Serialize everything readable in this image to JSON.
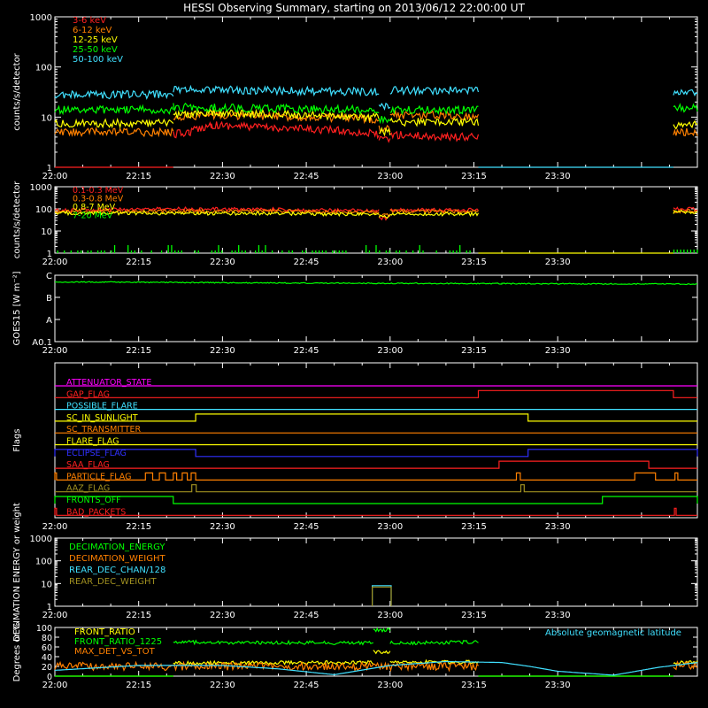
{
  "title": "HESSI Observing Summary, starting on 2013/06/12 22:00:00 UT",
  "time_ticks": [
    "22:00",
    "22:15",
    "22:30",
    "22:45",
    "23:00",
    "23:15",
    "23:30"
  ],
  "colors": {
    "red": "#ff2020",
    "orange": "#ff8000",
    "yellow": "#ffff00",
    "green": "#00ff00",
    "cyan": "#40e0ff",
    "magenta": "#ff00ff",
    "blue": "#3030ff",
    "olive": "#a09020",
    "white": "#ffffff",
    "frame": "#ffffff"
  },
  "chart_data": [
    {
      "type": "line",
      "ylabel": "counts/s/detector",
      "yscale": "log",
      "ylim": [
        1,
        1000
      ],
      "ytick_labels": [
        "1",
        "10",
        "100",
        "1000"
      ],
      "x_unit": "minutes since 22:00",
      "series": [
        {
          "name": "3-6 keV",
          "color": "#ff2020",
          "segments": [
            {
              "x": [
                0,
                21.2
              ],
              "y": [
                1,
                1
              ]
            },
            {
              "x": [
                21.2,
                24,
                28,
                40,
                50,
                58
              ],
              "y": [
                4.5,
                5,
                7,
                6,
                5.5,
                4.5
              ]
            },
            {
              "x": [
                58,
                60
              ],
              "y": [
                3.5,
                3.5
              ]
            },
            {
              "x": [
                60,
                70,
                75.8
              ],
              "y": [
                4.5,
                4,
                4
              ]
            }
          ]
        },
        {
          "name": "6-12 keV",
          "color": "#ff8000",
          "segments": [
            {
              "x": [
                0,
                21.2
              ],
              "y": [
                5,
                5
              ]
            },
            {
              "x": [
                21.2,
                28,
                45,
                58
              ],
              "y": [
                10,
                11,
                10,
                9
              ]
            },
            {
              "x": [
                58,
                60
              ],
              "y": [
                6,
                6
              ]
            },
            {
              "x": [
                60,
                70,
                75.8
              ],
              "y": [
                11,
                11,
                10
              ]
            },
            {
              "x": [
                110.7,
                115
              ],
              "y": [
                5,
                5
              ]
            }
          ]
        },
        {
          "name": "12-25 keV",
          "color": "#ffff00",
          "segments": [
            {
              "x": [
                0,
                21.2
              ],
              "y": [
                7.5,
                7.5
              ]
            },
            {
              "x": [
                21.2,
                28,
                45,
                58
              ],
              "y": [
                11,
                12,
                11,
                10
              ]
            },
            {
              "x": [
                58,
                60
              ],
              "y": [
                5,
                5
              ]
            },
            {
              "x": [
                60,
                75.8
              ],
              "y": [
                8,
                8
              ]
            },
            {
              "x": [
                110.7,
                115
              ],
              "y": [
                7,
                7
              ]
            }
          ]
        },
        {
          "name": "25-50 keV",
          "color": "#00ff00",
          "segments": [
            {
              "x": [
                0,
                21.2
              ],
              "y": [
                14,
                14
              ]
            },
            {
              "x": [
                21.2,
                35,
                58
              ],
              "y": [
                16,
                15,
                14
              ]
            },
            {
              "x": [
                58,
                60
              ],
              "y": [
                9,
                9
              ]
            },
            {
              "x": [
                60,
                75.8
              ],
              "y": [
                14,
                14
              ]
            },
            {
              "x": [
                110.7,
                115
              ],
              "y": [
                15,
                15
              ]
            }
          ]
        },
        {
          "name": "50-100 keV",
          "color": "#40e0ff",
          "segments": [
            {
              "x": [
                0,
                21.2
              ],
              "y": [
                28,
                28
              ]
            },
            {
              "x": [
                21.2,
                35,
                58
              ],
              "y": [
                36,
                34,
                32
              ]
            },
            {
              "x": [
                58,
                60
              ],
              "y": [
                17,
                17
              ]
            },
            {
              "x": [
                60,
                75.8
              ],
              "y": [
                34,
                34
              ]
            },
            {
              "x": [
                75.8,
                110.7
              ],
              "y": [
                1,
                1
              ]
            },
            {
              "x": [
                110.7,
                115
              ],
              "y": [
                32,
                32
              ]
            }
          ]
        }
      ]
    },
    {
      "type": "line",
      "ylabel": "counts/s/detector",
      "yscale": "log",
      "ylim": [
        1,
        1000
      ],
      "ytick_labels": [
        "1",
        "10",
        "100",
        "1000"
      ],
      "x_unit": "minutes since 22:00",
      "series": [
        {
          "name": "0.1-0.3 MeV",
          "color": "#ff2020",
          "segments": [
            {
              "x": [
                0,
                21.2,
                40,
                58
              ],
              "y": [
                85,
                100,
                95,
                80
              ]
            },
            {
              "x": [
                58,
                60
              ],
              "y": [
                38,
                38
              ]
            },
            {
              "x": [
                60,
                75.8
              ],
              "y": [
                90,
                88
              ]
            },
            {
              "x": [
                110.7,
                115
              ],
              "y": [
                100,
                100
              ]
            }
          ]
        },
        {
          "name": "0.3-0.8 MeV",
          "color": "#ff8000",
          "segments": [
            {
              "x": [
                0,
                40,
                58
              ],
              "y": [
                75,
                80,
                70
              ]
            },
            {
              "x": [
                58,
                60
              ],
              "y": [
                55,
                55
              ]
            },
            {
              "x": [
                60,
                75.8
              ],
              "y": [
                78,
                75
              ]
            },
            {
              "x": [
                110.7,
                115
              ],
              "y": [
                80,
                80
              ]
            }
          ]
        },
        {
          "name": "0.8-7 MeV",
          "color": "#ffff00",
          "segments": [
            {
              "x": [
                0,
                40,
                58
              ],
              "y": [
                65,
                62,
                55
              ]
            },
            {
              "x": [
                58,
                60
              ],
              "y": [
                45,
                45
              ]
            },
            {
              "x": [
                60,
                75.8
              ],
              "y": [
                60,
                58
              ]
            },
            {
              "x": [
                75.8,
                110.7
              ],
              "y": [
                1,
                1
              ]
            },
            {
              "x": [
                110.7,
                115
              ],
              "y": [
                70,
                70
              ]
            }
          ]
        },
        {
          "name": "7-20 MeV",
          "color": "#00ff00",
          "noise": true,
          "segments": [
            {
              "x": [
                0,
                75.8
              ],
              "y": [
                1,
                1
              ]
            },
            {
              "x": [
                110.7,
                115
              ],
              "y": [
                1,
                1
              ]
            }
          ]
        }
      ]
    },
    {
      "type": "line",
      "ylabel": "GOES15 [W m⁻²]",
      "ytick_labels": [
        "A0.1",
        "A",
        "B",
        "C"
      ],
      "series": [
        {
          "name": "GOES15",
          "color": "#00ff00",
          "segments": [
            {
              "x": [
                0,
                40,
                80,
                115
              ],
              "y": [
                2.7,
                2.65,
                2.62,
                2.6
              ]
            }
          ]
        }
      ]
    },
    {
      "type": "table",
      "ylabel": "Flags",
      "flags": [
        {
          "name": "ATTENUATOR_STATE",
          "color": "#ff00ff",
          "high": []
        },
        {
          "name": "GAP_FLAG",
          "color": "#ff2020",
          "high": [
            [
              75.8,
              110.7
            ]
          ]
        },
        {
          "name": "POSSIBLE_FLARE",
          "color": "#40e0ff",
          "high": []
        },
        {
          "name": "SC_IN_SUNLIGHT",
          "color": "#ffff00",
          "high": [
            [
              25.2,
              84.7
            ]
          ]
        },
        {
          "name": "SC_TRANSMITTER",
          "color": "#ff8000",
          "high": []
        },
        {
          "name": "FLARE_FLAG",
          "color": "#ffff00",
          "high": []
        },
        {
          "name": "ECLIPSE_FLAG",
          "color": "#3030ff",
          "high": [
            [
              0,
              25.2
            ],
            [
              84.7,
              115
            ]
          ]
        },
        {
          "name": "SAA_FLAG",
          "color": "#ff2020",
          "high": [
            [
              79.5,
              106.3
            ]
          ]
        },
        {
          "name": "PARTICLE_FLAG",
          "color": "#ff8000",
          "high": [
            [
              0,
              0.3
            ],
            [
              16.2,
              17.5
            ],
            [
              18.7,
              19.8
            ],
            [
              21.2,
              21.8
            ],
            [
              22.8,
              23.7
            ],
            [
              24.4,
              25.2
            ],
            [
              82.6,
              83.3
            ],
            [
              103.8,
              107.5
            ],
            [
              111,
              111.5
            ]
          ]
        },
        {
          "name": "AAZ_FLAG",
          "color": "#a09020",
          "high": [
            [
              24.5,
              25.3
            ],
            [
              83.4,
              84.0
            ]
          ]
        },
        {
          "name": "FRONTS_OFF",
          "color": "#00ff00",
          "high": [
            [
              0,
              21.2
            ],
            [
              98,
              115
            ]
          ]
        },
        {
          "name": "BAD_PACKETS",
          "color": "#ff2020",
          "high": [
            [
              0,
              0.3
            ],
            [
              110.9,
              111.2
            ]
          ]
        }
      ]
    },
    {
      "type": "line",
      "ylabel": "DECIMATION ENERGY or weight",
      "yscale": "log",
      "ylim": [
        1,
        1000
      ],
      "ytick_labels": [
        "1",
        "10",
        "100",
        "1000"
      ],
      "series": [
        {
          "name": "DECIMATION_ENERGY",
          "color": "#00ff00",
          "segments": []
        },
        {
          "name": "DECIMATION_WEIGHT",
          "color": "#ff8000",
          "segments": []
        },
        {
          "name": "REAR_DEC_CHAN/128",
          "color": "#40e0ff",
          "segments": [
            {
              "x": [
                56.8,
                56.8,
                60.2,
                60.2
              ],
              "y": [
                1,
                8,
                8,
                1
              ]
            }
          ]
        },
        {
          "name": "REAR_DEC_WEIGHT",
          "color": "#a09020",
          "segments": [
            {
              "x": [
                56.8,
                56.8,
                60.2,
                60.2
              ],
              "y": [
                1,
                7,
                7,
                1
              ]
            }
          ]
        }
      ]
    },
    {
      "type": "line",
      "ylabel": "Degrees or %",
      "ylim": [
        0,
        100
      ],
      "ytick_labels": [
        "0",
        "20",
        "40",
        "60",
        "80",
        "100"
      ],
      "annotation": "Absolute geomagnetic latitude",
      "series": [
        {
          "name": "FRONT_RATIO",
          "color": "#ffff00",
          "segments": [
            {
              "x": [
                0,
                21.2
              ],
              "y": [
                0,
                0
              ]
            },
            {
              "x": [
                21.2,
                57
              ],
              "y": [
                27,
                28
              ]
            },
            {
              "x": [
                57,
                60
              ],
              "y": [
                50,
                50
              ]
            },
            {
              "x": [
                60,
                75.8
              ],
              "y": [
                29,
                29
              ]
            },
            {
              "x": [
                75.8,
                110.7
              ],
              "y": [
                0,
                0
              ]
            },
            {
              "x": [
                110.7,
                115
              ],
              "y": [
                28,
                28
              ]
            }
          ]
        },
        {
          "name": "FRONT_RATIO_1225",
          "color": "#00ff00",
          "segments": [
            {
              "x": [
                0,
                21.2
              ],
              "y": [
                0,
                0
              ]
            },
            {
              "x": [
                21.2,
                57
              ],
              "y": [
                70,
                68
              ]
            },
            {
              "x": [
                57,
                60
              ],
              "y": [
                95,
                95
              ]
            },
            {
              "x": [
                60,
                75.8
              ],
              "y": [
                68,
                70
              ]
            },
            {
              "x": [
                75.8,
                110.7
              ],
              "y": [
                0,
                0
              ]
            }
          ]
        },
        {
          "name": "MAX_DET_VS_TOT",
          "color": "#ff8000",
          "segments": [
            {
              "x": [
                0,
                75.8
              ],
              "y": [
                20,
                20
              ]
            },
            {
              "x": [
                110.7,
                115
              ],
              "y": [
                22,
                22
              ]
            }
          ]
        },
        {
          "name": "geomagnetic",
          "color": "#40e0ff",
          "segments": [
            {
              "x": [
                0,
                15,
                30,
                40,
                50,
                60,
                70,
                80,
                85,
                90,
                100,
                108,
                115
              ],
              "y": [
                12,
                22,
                22,
                15,
                3,
                22,
                30,
                28,
                20,
                10,
                2,
                18,
                28
              ]
            }
          ]
        }
      ]
    }
  ]
}
